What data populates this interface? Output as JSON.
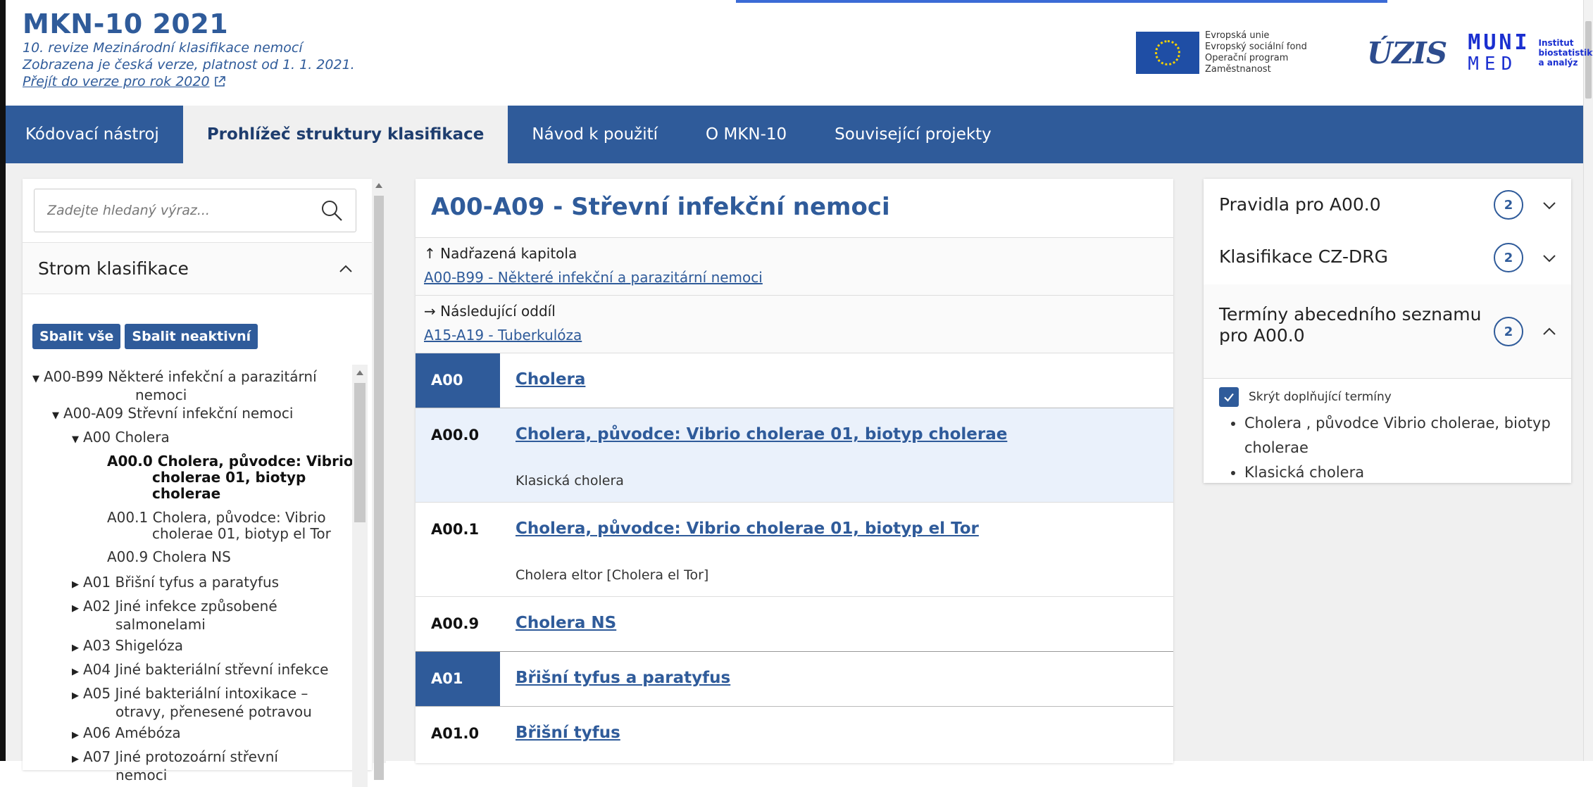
{
  "header": {
    "title": "MKN-10 2021",
    "subtitle1": "10. revize Mezinárodní klasifikace nemocí",
    "subtitle2": "Zobrazena je česká verze, platnost od 1. 1. 2021.",
    "version_link": "Přejít do verze pro rok 2020",
    "eu_line1": "Evropská unie",
    "eu_line2": "Evropský sociální fond",
    "eu_line3": "Operační program Zaměstnanost",
    "uzis_logo": "ÚZIS",
    "muni_line1": "MUNI",
    "muni_line2": "MED",
    "institute_line1": "Institut",
    "institute_line2": "biostatistiky",
    "institute_line3": "a analýz"
  },
  "nav": {
    "items": [
      {
        "label": "Kódovací nástroj"
      },
      {
        "label": "Prohlížeč struktury klasifikace"
      },
      {
        "label": "Návod k použití"
      },
      {
        "label": "O MKN-10"
      },
      {
        "label": "Související projekty"
      }
    ],
    "active_index": 1
  },
  "left": {
    "search_placeholder": "Zadejte hledaný výraz...",
    "tree_title": "Strom klasifikace",
    "collapse_all": "Sbalit vše",
    "collapse_inactive": "Sbalit neaktivní",
    "tree": [
      {
        "code": "A00-B99",
        "label": "Některé infekční a parazitární",
        "label2": "nemoci"
      },
      {
        "code": "A00-A09",
        "label": "Střevní infekční nemoci"
      },
      {
        "code": "A00",
        "label": "Cholera"
      },
      {
        "code": "A00.0",
        "label": "Cholera, původce: Vibrio",
        "label2": "cholerae 01, biotyp",
        "label3": "cholerae"
      },
      {
        "code": "A00.1",
        "label": "Cholera, původce: Vibrio",
        "label2": "cholerae 01, biotyp el Tor"
      },
      {
        "code": "A00.9",
        "label": "Cholera NS"
      },
      {
        "code": "A01",
        "label": "Břišní tyfus a paratyfus"
      },
      {
        "code": "A02",
        "label": "Jiné infekce způsobené",
        "label2": "salmonelami"
      },
      {
        "code": "A03",
        "label": "Shigelóza"
      },
      {
        "code": "A04",
        "label": "Jiné bakteriální střevní infekce"
      },
      {
        "code": "A05",
        "label": "Jiné bakteriální intoxikace –",
        "label2": "otravy, přenesené potravou"
      },
      {
        "code": "A06",
        "label": "Amébóza"
      },
      {
        "code": "A07",
        "label": "Jiné protozoární střevní",
        "label2": "nemoci"
      }
    ]
  },
  "center": {
    "title": "A00-A09 - Střevní infekční nemoci",
    "parent_label": "↑ Nadřazená kapitola",
    "parent_link": "A00-B99 - Některé infekční a parazitární nemoci",
    "next_label": "→ Následující oddíl",
    "next_link": "A15-A19 - Tuberkulóza",
    "rows": [
      {
        "code": "A00",
        "name": "Cholera",
        "note": ""
      },
      {
        "code": "A00.0",
        "name": "Cholera, původce: Vibrio cholerae 01, biotyp cholerae",
        "note": "Klasická cholera"
      },
      {
        "code": "A00.1",
        "name": "Cholera, původce: Vibrio cholerae 01, biotyp el Tor",
        "note": "Cholera eltor [Cholera el Tor]"
      },
      {
        "code": "A00.9",
        "name": "Cholera NS",
        "note": ""
      },
      {
        "code": "A01",
        "name": "Břišní tyfus a paratyfus",
        "note": ""
      },
      {
        "code": "A01.0",
        "name": "Břišní tyfus",
        "note": ""
      }
    ]
  },
  "right": {
    "sections": [
      {
        "title": "Pravidla pro A00.0",
        "title2": "",
        "count": "2"
      },
      {
        "title": "Klasifikace CZ-DRG",
        "title2": "",
        "count": "2"
      },
      {
        "title": "Termíny abecedního seznamu",
        "title2": "pro A00.0",
        "count": "2"
      }
    ],
    "hide_terms_label": "Skrýt doplňující termíny",
    "terms": [
      "Cholera , původce Vibrio cholerae, biotyp cholerae",
      "Klasická cholera"
    ]
  },
  "colors": {
    "accent": "#2f5b9a",
    "selected_row": "#eaf1fb"
  }
}
